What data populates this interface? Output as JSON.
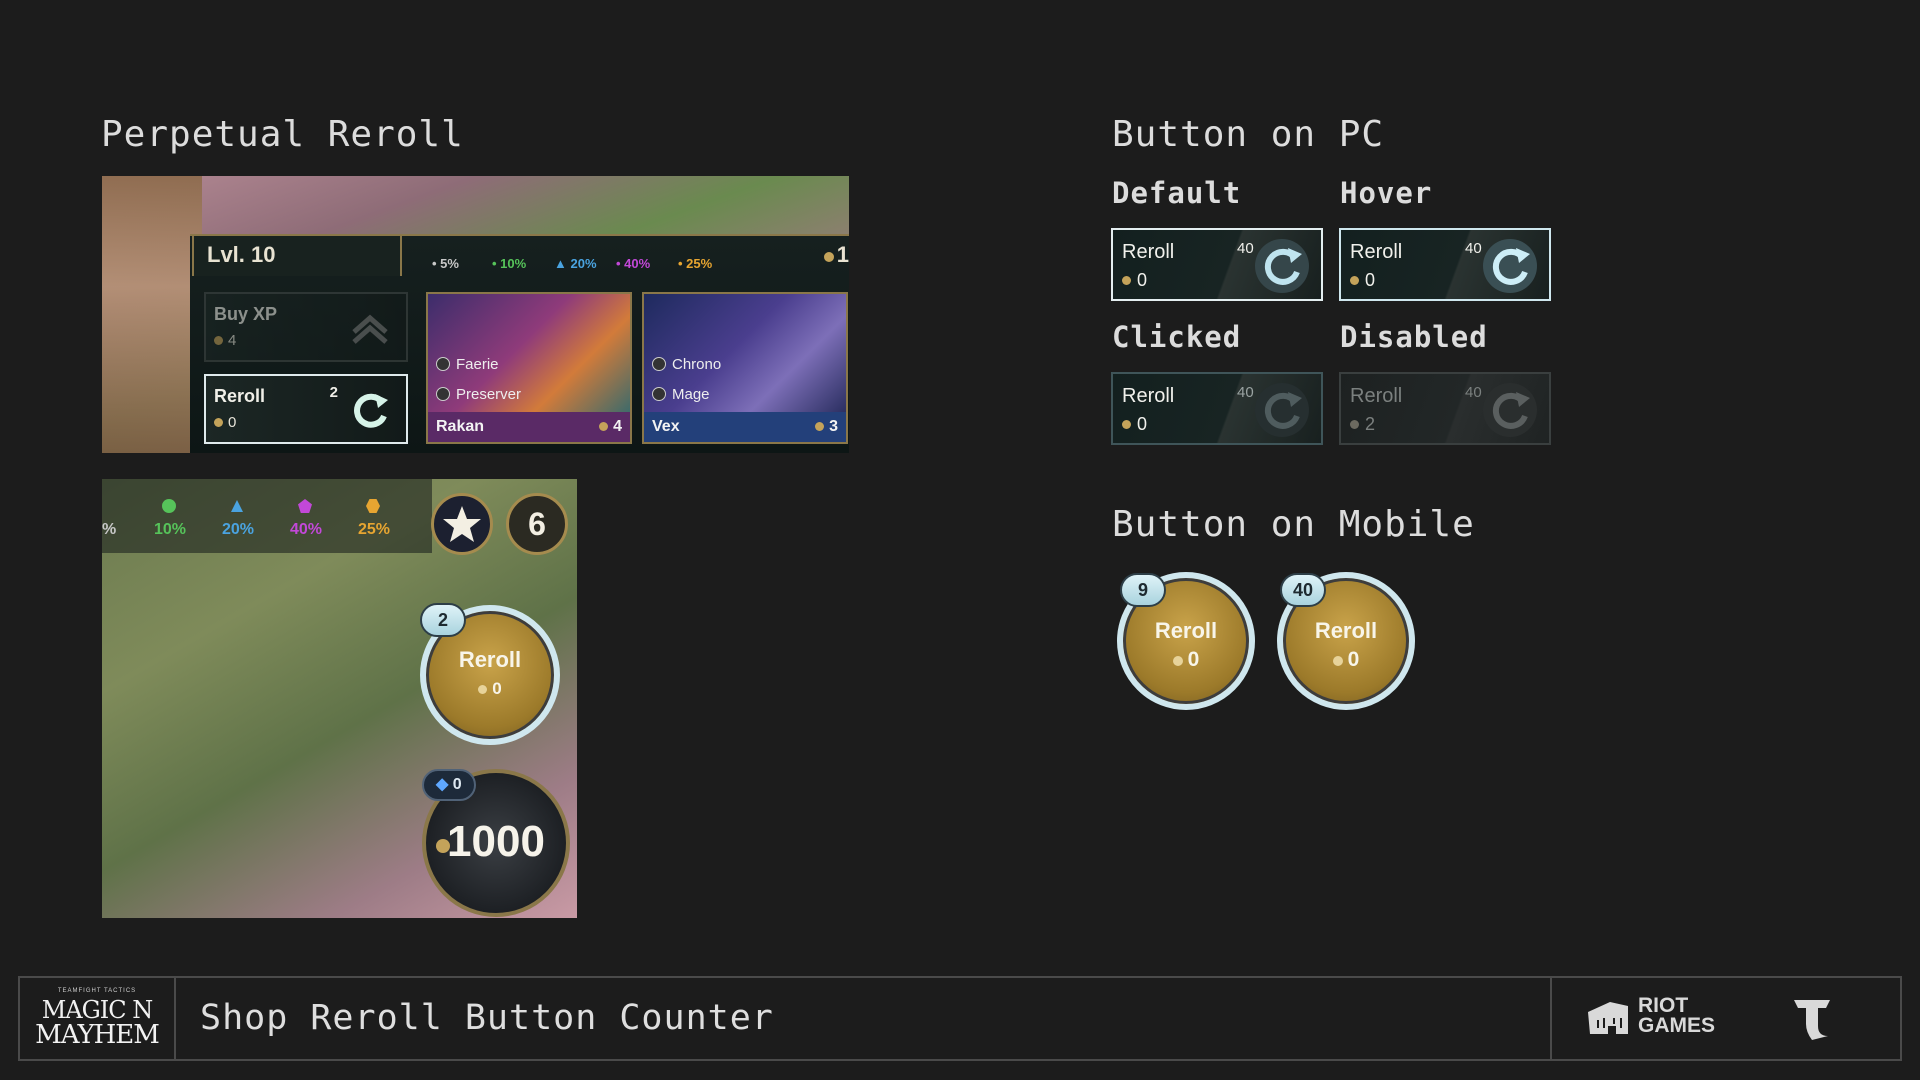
{
  "sections": {
    "perpetual": "Perpetual Reroll",
    "pc": "Button on PC",
    "mobile": "Button on Mobile"
  },
  "states": {
    "default": "Default",
    "hover": "Hover",
    "clicked": "Clicked",
    "disabled": "Disabled"
  },
  "pc_buttons": [
    {
      "label": "Reroll",
      "cost": "0",
      "counter": "40"
    },
    {
      "label": "Reroll",
      "cost": "0",
      "counter": "40"
    },
    {
      "label": "Reroll",
      "cost": "0",
      "counter": "40"
    },
    {
      "label": "Reroll",
      "cost": "2",
      "counter": "40"
    }
  ],
  "mobile_buttons": [
    {
      "label": "Reroll",
      "cost": "0",
      "counter": "9"
    },
    {
      "label": "Reroll",
      "cost": "0",
      "counter": "40"
    }
  ],
  "pc_shot": {
    "level": "Lvl. 10",
    "gold_partial": "1",
    "odds": [
      "5%",
      "10%",
      "20%",
      "40%",
      "25%"
    ],
    "buy_xp": {
      "label": "Buy XP",
      "cost": "4"
    },
    "reroll": {
      "label": "Reroll",
      "cost": "0",
      "counter": "2"
    },
    "champions": [
      {
        "traits": [
          "Faerie",
          "Preserver"
        ],
        "name": "Rakan",
        "cost": "4"
      },
      {
        "traits": [
          "Chrono",
          "Mage"
        ],
        "name": "Vex",
        "cost": "3"
      }
    ]
  },
  "mobile_shot": {
    "odds_partial": "%",
    "odds": [
      "10%",
      "20%",
      "40%",
      "25%"
    ],
    "level_badge": "6",
    "reroll": {
      "label": "Reroll",
      "cost": "0",
      "counter": "2"
    },
    "streak": "0",
    "gold": "1000"
  },
  "footer": {
    "logo_small": "TEAMFIGHT TACTICS",
    "logo_top": "MAGIC N",
    "logo_bottom": "MAYHEM",
    "title": "Shop Reroll Button Counter",
    "publisher_line1": "RIOT",
    "publisher_line2": "GAMES"
  },
  "colors": {
    "background": "#1c1c1c",
    "odds": [
      "#c8c8c8",
      "#56c35a",
      "#4aa3e0",
      "#c248d8",
      "#e7a531"
    ],
    "mobile_ring": "#cfe7ee",
    "gold": "#c4a35a"
  },
  "icons": [
    "reroll-arrow-icon",
    "gold-coin-icon",
    "buy-xp-chevron-icon",
    "star-icon",
    "streak-flame-icon",
    "riot-fist-icon",
    "tft-logo-icon"
  ]
}
